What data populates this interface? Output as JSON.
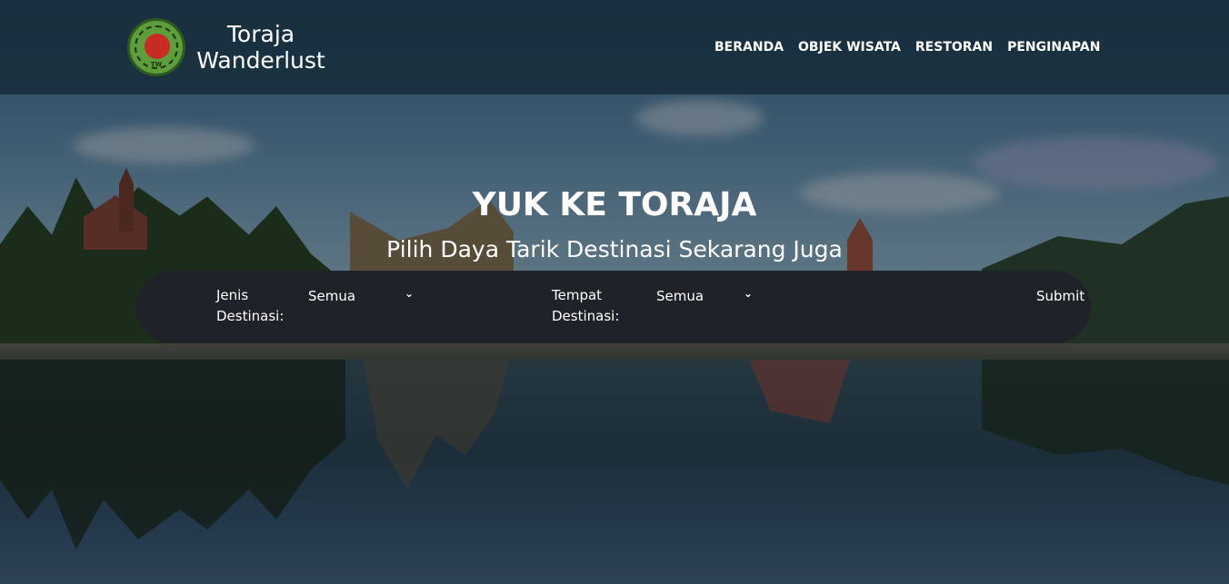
{
  "brand": {
    "name_line1": "Toraja",
    "name_line2": "Wanderlust",
    "logo_text_top": "TORAJA WANDERLUST",
    "logo_text_bottom": "TW"
  },
  "nav": {
    "items": [
      {
        "label": "BERANDA"
      },
      {
        "label": "OBJEK WISATA"
      },
      {
        "label": "RESTORAN"
      },
      {
        "label": "PENGINAPAN"
      }
    ]
  },
  "hero": {
    "title": "YUK KE TORAJA",
    "subtitle": "Pilih Daya Tarik Destinasi Sekarang Juga"
  },
  "search": {
    "jenis_label_1": "Jenis",
    "jenis_label_2": "Destinasi:",
    "jenis_value": "Semua",
    "tempat_label_1": "Tempat",
    "tempat_label_2": "Destinasi:",
    "tempat_value": "Semua",
    "submit_label": "Submit"
  },
  "colors": {
    "navbar_bg": "#162c3a",
    "search_bg": "#1f2228",
    "text": "#ffffff"
  },
  "icons": [
    "chevron-down-icon"
  ]
}
